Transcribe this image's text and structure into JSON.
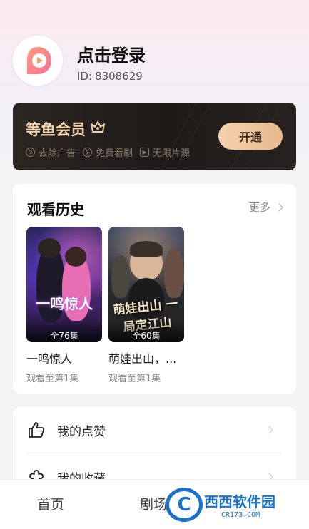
{
  "profile": {
    "login_title": "点击登录",
    "id_label": "ID:",
    "id_value": "8308629"
  },
  "vip": {
    "title": "等鱼会员",
    "benefits": [
      {
        "icon": "ad-block-icon",
        "label": "去除广告"
      },
      {
        "icon": "free-watch-icon",
        "label": "免费看剧"
      },
      {
        "icon": "play-icon",
        "label": "无限片源"
      }
    ],
    "open_button": "开通",
    "accent_color": "#f1d2ad"
  },
  "history": {
    "title": "观看历史",
    "more_label": "更多",
    "items": [
      {
        "poster_title": "一鸣惊人",
        "episodes": "全76集",
        "name": "一鸣惊人",
        "progress": "观看至第1集"
      },
      {
        "poster_title": "萌娃出山 一局定江山",
        "episodes": "全60集",
        "name": "萌娃出山，...",
        "progress": "观看至第1集"
      }
    ]
  },
  "menu": {
    "items": [
      {
        "icon": "thumbs-up-icon",
        "label": "我的点赞"
      },
      {
        "icon": "collection-icon",
        "label": "我的收藏"
      }
    ]
  },
  "tab_bar": {
    "tabs": [
      {
        "label": "首页"
      },
      {
        "label": "剧场"
      }
    ]
  },
  "watermark": {
    "logo": "C",
    "text_main": "西西软件园",
    "text_sub": "CR173.COM"
  }
}
